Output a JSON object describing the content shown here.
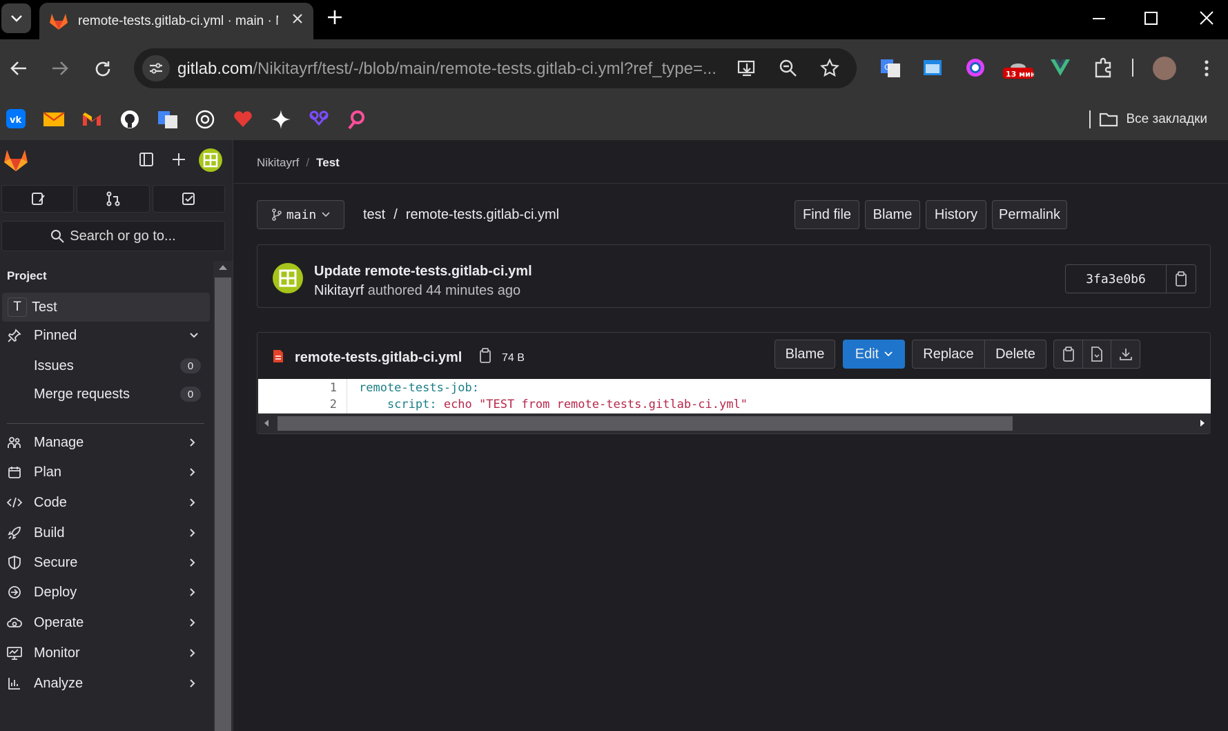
{
  "browser": {
    "tab_title": "remote-tests.gitlab-ci.yml · main · N",
    "url_host": "gitlab.com",
    "url_path": "/Nikitayrf/test/-/blob/main/remote-tests.gitlab-ci.yml?ref_type=...",
    "extension_badge": "13 мин",
    "all_bookmarks": "Все закладки"
  },
  "sidebar": {
    "search_placeholder": "Search or go to...",
    "section_label": "Project",
    "project_initial": "T",
    "project_name": "Test",
    "pinned_label": "Pinned",
    "pinned_items": [
      {
        "label": "Issues",
        "count": "0"
      },
      {
        "label": "Merge requests",
        "count": "0"
      }
    ],
    "nav_items": [
      {
        "label": "Manage",
        "icon": "users-icon"
      },
      {
        "label": "Plan",
        "icon": "calendar-icon"
      },
      {
        "label": "Code",
        "icon": "code-icon"
      },
      {
        "label": "Build",
        "icon": "rocket-icon"
      },
      {
        "label": "Secure",
        "icon": "shield-icon"
      },
      {
        "label": "Deploy",
        "icon": "deploy-icon"
      },
      {
        "label": "Operate",
        "icon": "cloud-gear-icon"
      },
      {
        "label": "Monitor",
        "icon": "monitor-icon"
      },
      {
        "label": "Analyze",
        "icon": "chart-icon"
      }
    ]
  },
  "breadcrumb": {
    "owner": "Nikitayrf",
    "separator": "/",
    "project": "Test"
  },
  "repo": {
    "branch": "main",
    "path_root": "test",
    "path_sep": "/",
    "path_file": "remote-tests.gitlab-ci.yml",
    "actions": {
      "find_file": "Find file",
      "blame": "Blame",
      "history": "History",
      "permalink": "Permalink"
    }
  },
  "commit": {
    "title": "Update remote-tests.gitlab-ci.yml",
    "author": "Nikitayrf",
    "authored_text": "authored 44 minutes ago",
    "sha": "3fa3e0b6"
  },
  "file": {
    "name": "remote-tests.gitlab-ci.yml",
    "size": "74 B",
    "blame": "Blame",
    "edit": "Edit",
    "replace": "Replace",
    "delete": "Delete",
    "lines": [
      {
        "n": "1",
        "key": "remote-tests-job:",
        "val": ""
      },
      {
        "n": "2",
        "key": "    script:",
        "val": " echo \"TEST from remote-tests.gitlab-ci.yml\""
      }
    ]
  },
  "colors": {
    "accent_blue": "#1f75cb",
    "gitlab_orange": "#fc6d26",
    "avatar_green": "#a6c41a"
  }
}
